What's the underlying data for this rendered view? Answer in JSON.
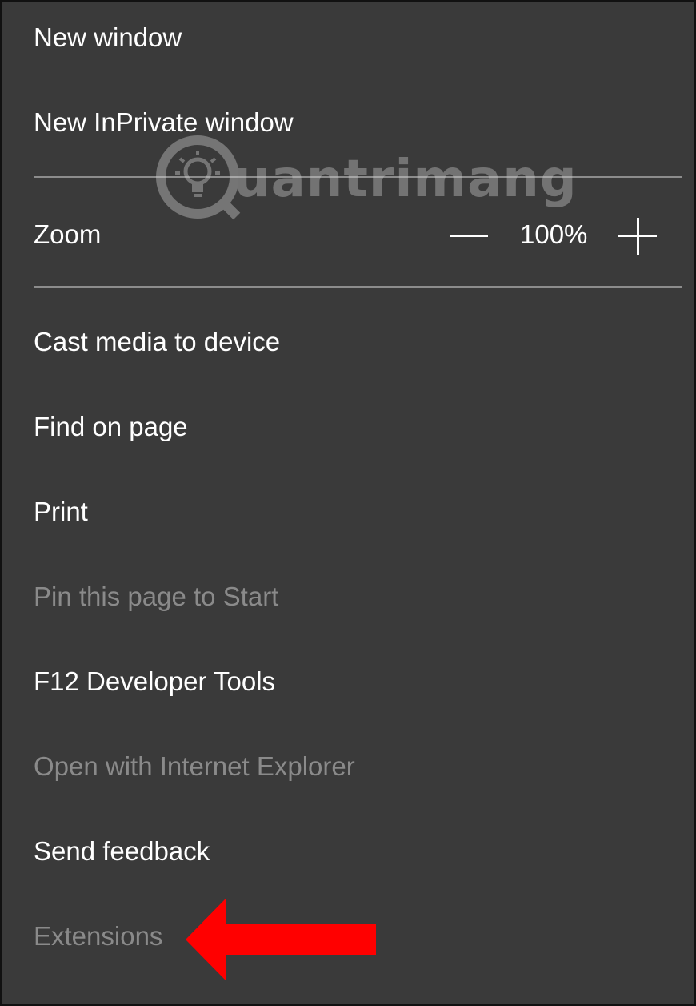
{
  "menu": {
    "items_top": [
      {
        "label": "New window",
        "enabled": true
      },
      {
        "label": "New InPrivate window",
        "enabled": true
      }
    ],
    "zoom": {
      "label": "Zoom",
      "value": "100%",
      "decrease_icon": "minus-icon",
      "increase_icon": "plus-icon"
    },
    "items_bottom": [
      {
        "label": "Cast media to device",
        "enabled": true
      },
      {
        "label": "Find on page",
        "enabled": true
      },
      {
        "label": "Print",
        "enabled": true
      },
      {
        "label": "Pin this page to Start",
        "enabled": false
      },
      {
        "label": "F12 Developer Tools",
        "enabled": true
      },
      {
        "label": "Open with Internet Explorer",
        "enabled": false
      },
      {
        "label": "Send feedback",
        "enabled": true
      },
      {
        "label": "Extensions",
        "enabled": false
      }
    ]
  },
  "watermark": {
    "text": "uantrimang",
    "icon": "lightbulb-logo-icon"
  },
  "annotation": {
    "icon": "red-arrow-icon",
    "color": "#ff0000"
  },
  "colors": {
    "menu_background": "#3a3a3a",
    "enabled_text": "#ffffff",
    "disabled_text": "#8a8a8a",
    "divider": "#8c8c8c"
  }
}
